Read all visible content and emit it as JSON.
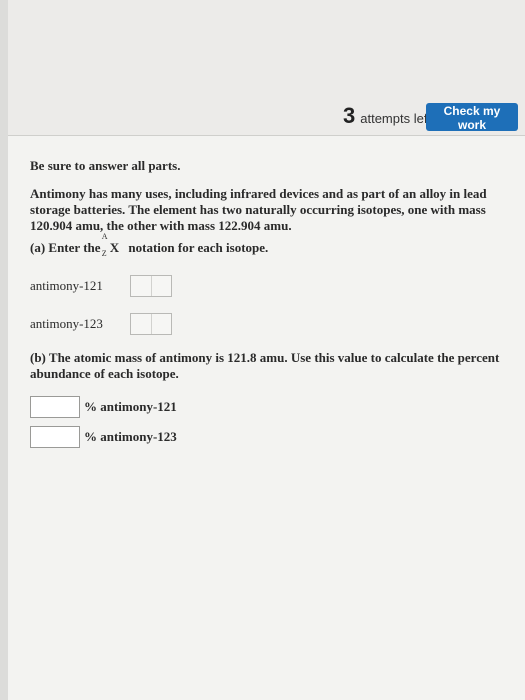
{
  "header": {
    "attempts_count": "3",
    "attempts_text": "attempts left",
    "check_button": "Check my work"
  },
  "question": {
    "instructions": "Be sure to answer all parts.",
    "problem_text": "Antimony has many uses, including infrared devices and as part of an alloy in lead storage batteries. The element has two naturally occurring isotopes, one with mass 120.904 amu, the other with mass 122.904 amu.",
    "part_a_prefix": "(a) Enter the",
    "part_a_symbol": "X",
    "part_a_sup": "A",
    "part_a_sub": "Z",
    "part_a_suffix": "notation for each isotope.",
    "isotopes": [
      {
        "label": "antimony-121"
      },
      {
        "label": "antimony-123"
      }
    ],
    "part_b_text": "(b) The atomic mass of antimony is 121.8 amu. Use this value to calculate the percent abundance of each isotope.",
    "percent_fields": [
      {
        "label": "% antimony-121",
        "value": ""
      },
      {
        "label": "% antimony-123",
        "value": ""
      }
    ]
  }
}
